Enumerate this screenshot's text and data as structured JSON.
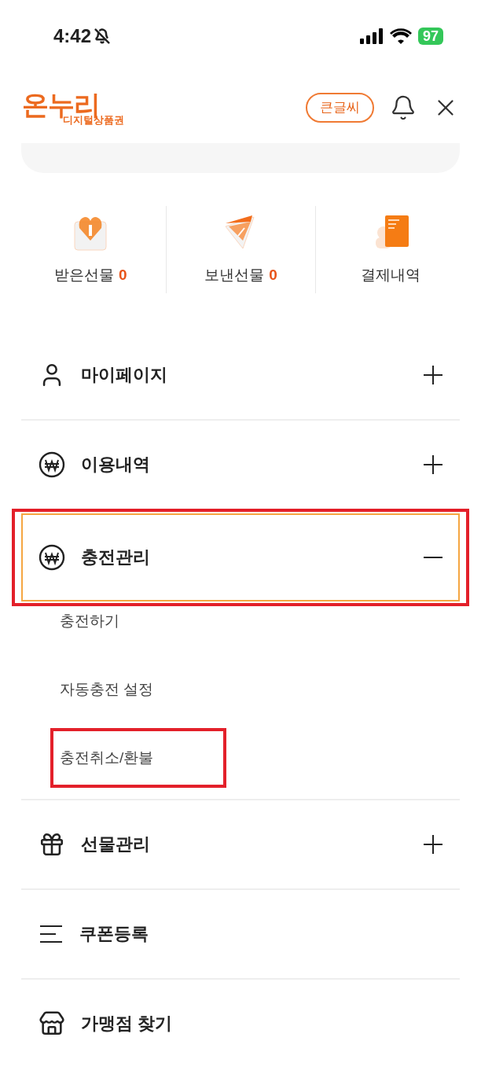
{
  "status_bar": {
    "time": "4:42",
    "silent": true,
    "battery": "97"
  },
  "header": {
    "logo_main": "온누리",
    "logo_sub": "디지털상품권",
    "large_text_button": "큰글씨"
  },
  "quick_links": [
    {
      "kind": "received",
      "label": "받은선물",
      "count": "0"
    },
    {
      "kind": "sent",
      "label": "보낸선물",
      "count": "0"
    },
    {
      "kind": "payments",
      "label": "결제내역"
    }
  ],
  "menu": [
    {
      "kind": "user",
      "label": "마이페이지",
      "expanded": false,
      "selected": false,
      "highlighted": false
    },
    {
      "kind": "won",
      "label": "이용내역",
      "expanded": false,
      "selected": false,
      "highlighted": false
    },
    {
      "kind": "won",
      "label": "충전관리",
      "expanded": true,
      "selected": true,
      "highlighted": true,
      "children": [
        {
          "label": "충전하기",
          "highlighted": false
        },
        {
          "label": "자동충전 설정",
          "highlighted": false
        },
        {
          "label": "충전취소/환불",
          "highlighted": true
        }
      ]
    },
    {
      "kind": "gift",
      "label": "선물관리",
      "expanded": false,
      "selected": false,
      "highlighted": false
    },
    {
      "kind": "coupon",
      "label": "쿠폰등록",
      "highlighted": false
    },
    {
      "kind": "store",
      "label": "가맹점 찾기",
      "highlighted": false
    }
  ]
}
